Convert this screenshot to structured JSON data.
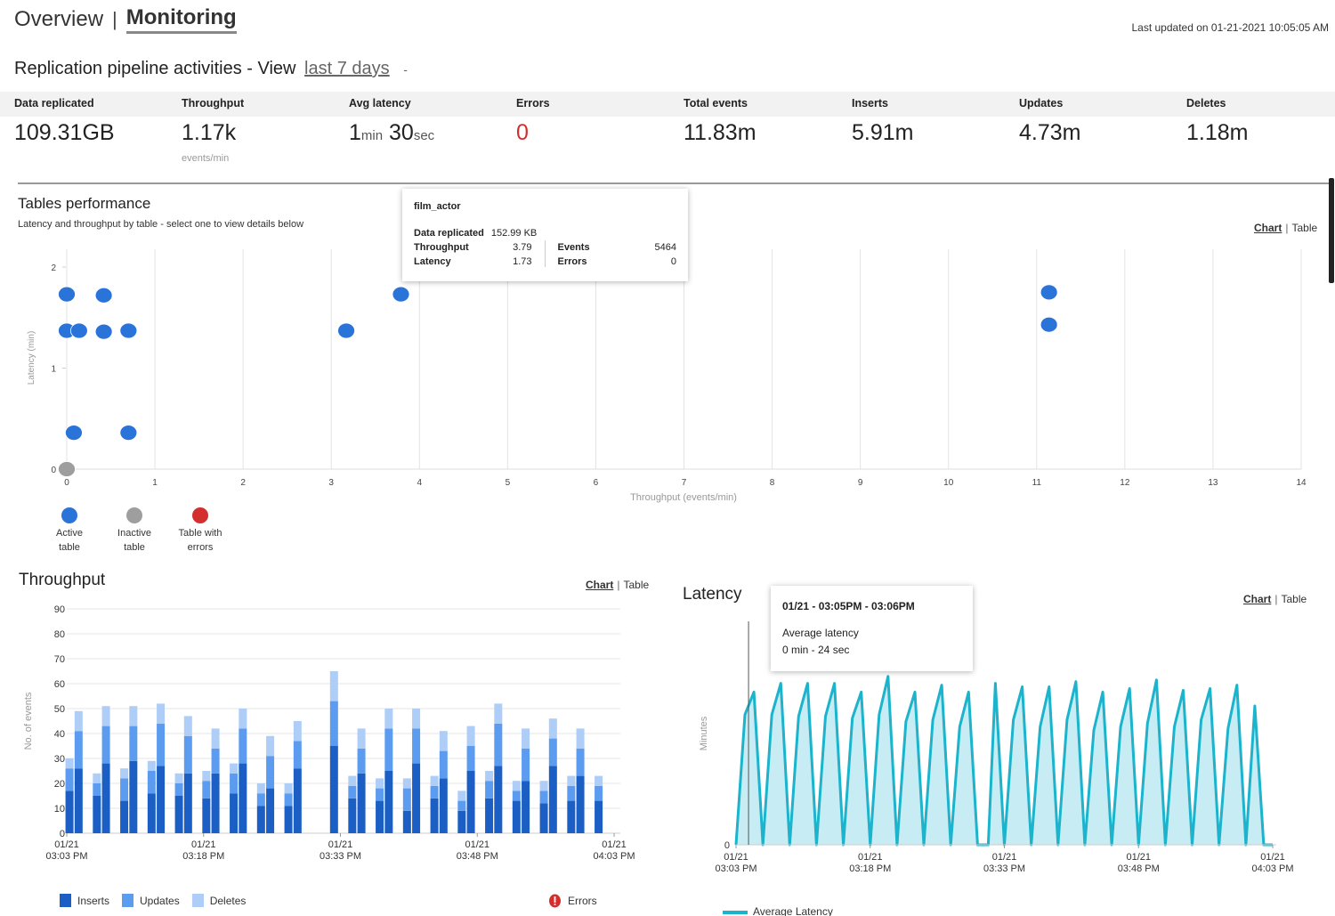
{
  "header": {
    "tabs": [
      {
        "label": "Overview",
        "active": false
      },
      {
        "label": "Monitoring",
        "active": true
      }
    ],
    "separator": "|",
    "last_updated": "Last updated on  01-21-2021 10:05:05 AM"
  },
  "pipeline": {
    "title": "Replication pipeline activities - View",
    "period": "last 7 days",
    "caret": "-"
  },
  "stats": [
    {
      "label": "Data replicated",
      "value": "109.31GB"
    },
    {
      "label": "Throughput",
      "value": "1.17k",
      "sub": "events/min"
    },
    {
      "label": "Avg latency",
      "min": "1",
      "min_unit": "min",
      "sec": "30",
      "sec_unit": "sec"
    },
    {
      "label": "Errors",
      "value": "0"
    },
    {
      "label": "Total events",
      "value": "11.83m"
    },
    {
      "label": "Inserts",
      "value": "5.91m"
    },
    {
      "label": "Updates",
      "value": "4.73m"
    },
    {
      "label": "Deletes",
      "value": "1.18m"
    }
  ],
  "toggle": {
    "chart": "Chart",
    "table": "Table",
    "sep": "|"
  },
  "tables_performance": {
    "title": "Tables performance",
    "subtitle": "Latency and throughput by table - select one to view details below",
    "tooltip": {
      "name": "film_actor",
      "data_replicated_label": "Data replicated",
      "data_replicated": "152.99 KB",
      "throughput_label": "Throughput",
      "throughput": "3.79",
      "latency_label": "Latency",
      "latency": "1.73",
      "events_label": "Events",
      "events": "5464",
      "errors_label": "Errors",
      "errors": "0"
    },
    "legend": [
      {
        "label1": "Active",
        "label2": "table",
        "color": "#2a73d9"
      },
      {
        "label1": "Inactive",
        "label2": "table",
        "color": "#9e9e9e"
      },
      {
        "label1": "Table with",
        "label2": "errors",
        "color": "#d32f2f"
      }
    ]
  },
  "throughput": {
    "title": "Throughput",
    "legend": {
      "inserts": "Inserts",
      "updates": "Updates",
      "deletes": "Deletes",
      "errors": "Errors"
    }
  },
  "latency": {
    "title": "Latency",
    "tooltip": {
      "range": "01/21 - 03:05PM - 03:06PM",
      "label": "Average latency",
      "value": "0 min - 24 sec"
    },
    "legend": "Average Latency"
  },
  "chart_data": [
    {
      "type": "scatter",
      "title": "Tables performance",
      "xlabel": "Throughput (events/min)",
      "ylabel": "Latency (min)",
      "xlim": [
        0,
        14
      ],
      "ylim": [
        0,
        2
      ],
      "xticks": [
        0,
        1,
        2,
        3,
        4,
        5,
        6,
        7,
        8,
        9,
        10,
        11,
        12,
        13,
        14
      ],
      "yticks": [
        0,
        1,
        2
      ],
      "grid": "vertical",
      "series": [
        {
          "name": "Active table",
          "color": "#2a73d9",
          "points": [
            [
              0.0,
              1.73
            ],
            [
              0.42,
              1.72
            ],
            [
              0.0,
              1.37
            ],
            [
              0.14,
              1.37
            ],
            [
              0.42,
              1.36
            ],
            [
              0.7,
              1.37
            ],
            [
              0.08,
              0.36
            ],
            [
              0.7,
              0.36
            ],
            [
              3.17,
              1.37
            ],
            [
              3.79,
              1.73
            ],
            [
              11.14,
              1.75
            ],
            [
              11.14,
              1.43
            ]
          ]
        },
        {
          "name": "Inactive table",
          "color": "#9e9e9e",
          "points": [
            [
              0.0,
              0.0
            ]
          ]
        },
        {
          "name": "Table with errors",
          "color": "#d32f2f",
          "points": []
        }
      ]
    },
    {
      "type": "bar",
      "stacked": true,
      "title": "Throughput",
      "ylabel": "No. of events",
      "ylim": [
        0,
        90
      ],
      "yticks": [
        0,
        10,
        20,
        30,
        40,
        50,
        60,
        70,
        80,
        90
      ],
      "xtick_labels": [
        [
          "01/21",
          "03:03 PM"
        ],
        [
          "01/21",
          "03:18 PM"
        ],
        [
          "01/21",
          "03:33 PM"
        ],
        [
          "01/21",
          "03:48 PM"
        ],
        [
          "01/21",
          "04:03 PM"
        ]
      ],
      "x_minutes_range": [
        0,
        60
      ],
      "bars": [
        {
          "t": 0.3,
          "ins": 17,
          "upd": 9,
          "del": 4
        },
        {
          "t": 1.3,
          "ins": 26,
          "upd": 15,
          "del": 8
        },
        {
          "t": 3.3,
          "ins": 15,
          "upd": 5,
          "del": 4
        },
        {
          "t": 4.3,
          "ins": 28,
          "upd": 15,
          "del": 8
        },
        {
          "t": 6.3,
          "ins": 13,
          "upd": 9,
          "del": 4
        },
        {
          "t": 7.3,
          "ins": 29,
          "upd": 14,
          "del": 8
        },
        {
          "t": 9.3,
          "ins": 16,
          "upd": 9,
          "del": 4
        },
        {
          "t": 10.3,
          "ins": 27,
          "upd": 17,
          "del": 8
        },
        {
          "t": 12.3,
          "ins": 15,
          "upd": 5,
          "del": 4
        },
        {
          "t": 13.3,
          "ins": 24,
          "upd": 15,
          "del": 8
        },
        {
          "t": 15.3,
          "ins": 14,
          "upd": 7,
          "del": 4
        },
        {
          "t": 16.3,
          "ins": 24,
          "upd": 10,
          "del": 8
        },
        {
          "t": 18.3,
          "ins": 16,
          "upd": 8,
          "del": 4
        },
        {
          "t": 19.3,
          "ins": 28,
          "upd": 14,
          "del": 8
        },
        {
          "t": 21.3,
          "ins": 11,
          "upd": 5,
          "del": 4
        },
        {
          "t": 22.3,
          "ins": 18,
          "upd": 13,
          "del": 8
        },
        {
          "t": 24.3,
          "ins": 11,
          "upd": 5,
          "del": 4
        },
        {
          "t": 25.3,
          "ins": 26,
          "upd": 11,
          "del": 8
        },
        {
          "t": 29.3,
          "ins": 35,
          "upd": 18,
          "del": 12
        },
        {
          "t": 31.3,
          "ins": 14,
          "upd": 5,
          "del": 4
        },
        {
          "t": 32.3,
          "ins": 24,
          "upd": 10,
          "del": 8
        },
        {
          "t": 34.3,
          "ins": 13,
          "upd": 5,
          "del": 4
        },
        {
          "t": 35.3,
          "ins": 25,
          "upd": 17,
          "del": 8
        },
        {
          "t": 37.3,
          "ins": 9,
          "upd": 9,
          "del": 4
        },
        {
          "t": 38.3,
          "ins": 28,
          "upd": 14,
          "del": 8
        },
        {
          "t": 40.3,
          "ins": 14,
          "upd": 5,
          "del": 4
        },
        {
          "t": 41.3,
          "ins": 22,
          "upd": 11,
          "del": 8
        },
        {
          "t": 43.3,
          "ins": 9,
          "upd": 4,
          "del": 4
        },
        {
          "t": 44.3,
          "ins": 25,
          "upd": 10,
          "del": 8
        },
        {
          "t": 46.3,
          "ins": 14,
          "upd": 7,
          "del": 4
        },
        {
          "t": 47.3,
          "ins": 27,
          "upd": 17,
          "del": 8
        },
        {
          "t": 49.3,
          "ins": 13,
          "upd": 4,
          "del": 4
        },
        {
          "t": 50.3,
          "ins": 21,
          "upd": 13,
          "del": 8
        },
        {
          "t": 52.3,
          "ins": 12,
          "upd": 5,
          "del": 4
        },
        {
          "t": 53.3,
          "ins": 27,
          "upd": 11,
          "del": 8
        },
        {
          "t": 55.3,
          "ins": 13,
          "upd": 6,
          "del": 4
        },
        {
          "t": 56.3,
          "ins": 23,
          "upd": 11,
          "del": 8
        },
        {
          "t": 58.3,
          "ins": 13,
          "upd": 6,
          "del": 4
        }
      ],
      "colors": {
        "ins": "#1b5fc4",
        "upd": "#5c9cf0",
        "del": "#aecdf7"
      },
      "series_names": [
        "Inserts",
        "Updates",
        "Deletes"
      ]
    },
    {
      "type": "area",
      "title": "Latency",
      "ylabel": "Minutes",
      "ytick_labels": [
        "0"
      ],
      "xtick_labels": [
        [
          "01/21",
          "03:03 PM"
        ],
        [
          "01/21",
          "03:18 PM"
        ],
        [
          "01/21",
          "03:33 PM"
        ],
        [
          "01/21",
          "03:48 PM"
        ],
        [
          "01/21",
          "04:03 PM"
        ]
      ],
      "x_minutes_range": [
        0,
        60
      ],
      "y_range_relative": [
        0,
        1
      ],
      "color": "#1cb3cc",
      "fill": "#c7ecf4",
      "series": [
        {
          "name": "Average Latency",
          "points": [
            [
              0,
              0
            ],
            [
              1,
              0.75
            ],
            [
              2,
              0.88
            ],
            [
              3,
              0
            ],
            [
              4,
              0.75
            ],
            [
              5,
              0.93
            ],
            [
              6,
              0
            ],
            [
              7,
              0.74
            ],
            [
              8,
              0.93
            ],
            [
              9,
              0
            ],
            [
              10,
              0.74
            ],
            [
              11,
              0.93
            ],
            [
              12,
              0
            ],
            [
              13,
              0.73
            ],
            [
              14,
              0.88
            ],
            [
              15,
              0
            ],
            [
              16,
              0.75
            ],
            [
              17,
              0.97
            ],
            [
              18,
              0
            ],
            [
              19,
              0.71
            ],
            [
              20,
              0.88
            ],
            [
              21,
              0
            ],
            [
              22,
              0.72
            ],
            [
              23,
              0.92
            ],
            [
              24,
              0
            ],
            [
              25,
              0.68
            ],
            [
              26,
              0.88
            ],
            [
              27,
              0
            ],
            [
              27.6,
              0
            ],
            [
              28.2,
              0
            ],
            [
              29,
              0.93
            ],
            [
              30,
              0
            ],
            [
              31,
              0.72
            ],
            [
              32,
              0.91
            ],
            [
              33,
              0
            ],
            [
              34,
              0.68
            ],
            [
              35,
              0.91
            ],
            [
              36,
              0
            ],
            [
              37,
              0.72
            ],
            [
              38,
              0.94
            ],
            [
              39,
              0
            ],
            [
              40,
              0.66
            ],
            [
              41,
              0.88
            ],
            [
              42,
              0
            ],
            [
              43,
              0.68
            ],
            [
              44,
              0.9
            ],
            [
              45,
              0
            ],
            [
              46,
              0.7
            ],
            [
              47,
              0.95
            ],
            [
              48,
              0
            ],
            [
              49,
              0.68
            ],
            [
              50,
              0.89
            ],
            [
              51,
              0
            ],
            [
              52,
              0.72
            ],
            [
              53,
              0.9
            ],
            [
              54,
              0
            ],
            [
              55,
              0.67
            ],
            [
              56,
              0.92
            ],
            [
              57,
              0
            ],
            [
              58,
              0.8
            ],
            [
              59,
              0
            ],
            [
              60,
              0
            ]
          ]
        }
      ],
      "hover_marker_minute": 1.4
    }
  ]
}
